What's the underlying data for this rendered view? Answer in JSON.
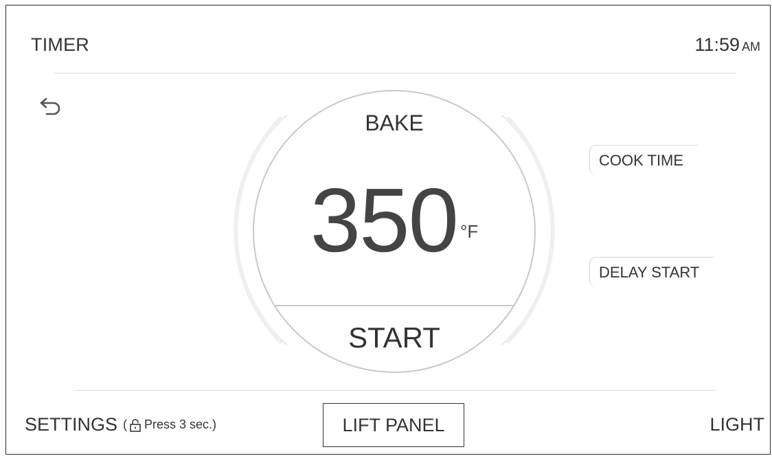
{
  "header": {
    "timer_label": "TIMER",
    "time": "11:59",
    "ampm": "AM"
  },
  "dial": {
    "mode": "BAKE",
    "temperature": "350",
    "unit": "°F",
    "start_label": "START"
  },
  "side_buttons": {
    "cook_time": "COOK TIME",
    "delay_start": "DELAY START"
  },
  "footer": {
    "settings_label": "SETTINGS",
    "settings_hint_open": "(",
    "settings_hint": "Press 3 sec.)",
    "lift_panel": "LIFT PANEL",
    "light": "LIGHT"
  },
  "icons": {
    "back": "undo-arrow-icon",
    "lock": "lock-icon"
  },
  "colors": {
    "text": "#333333",
    "divider": "#dcdcdc",
    "dial_border": "#c8c8c8"
  }
}
